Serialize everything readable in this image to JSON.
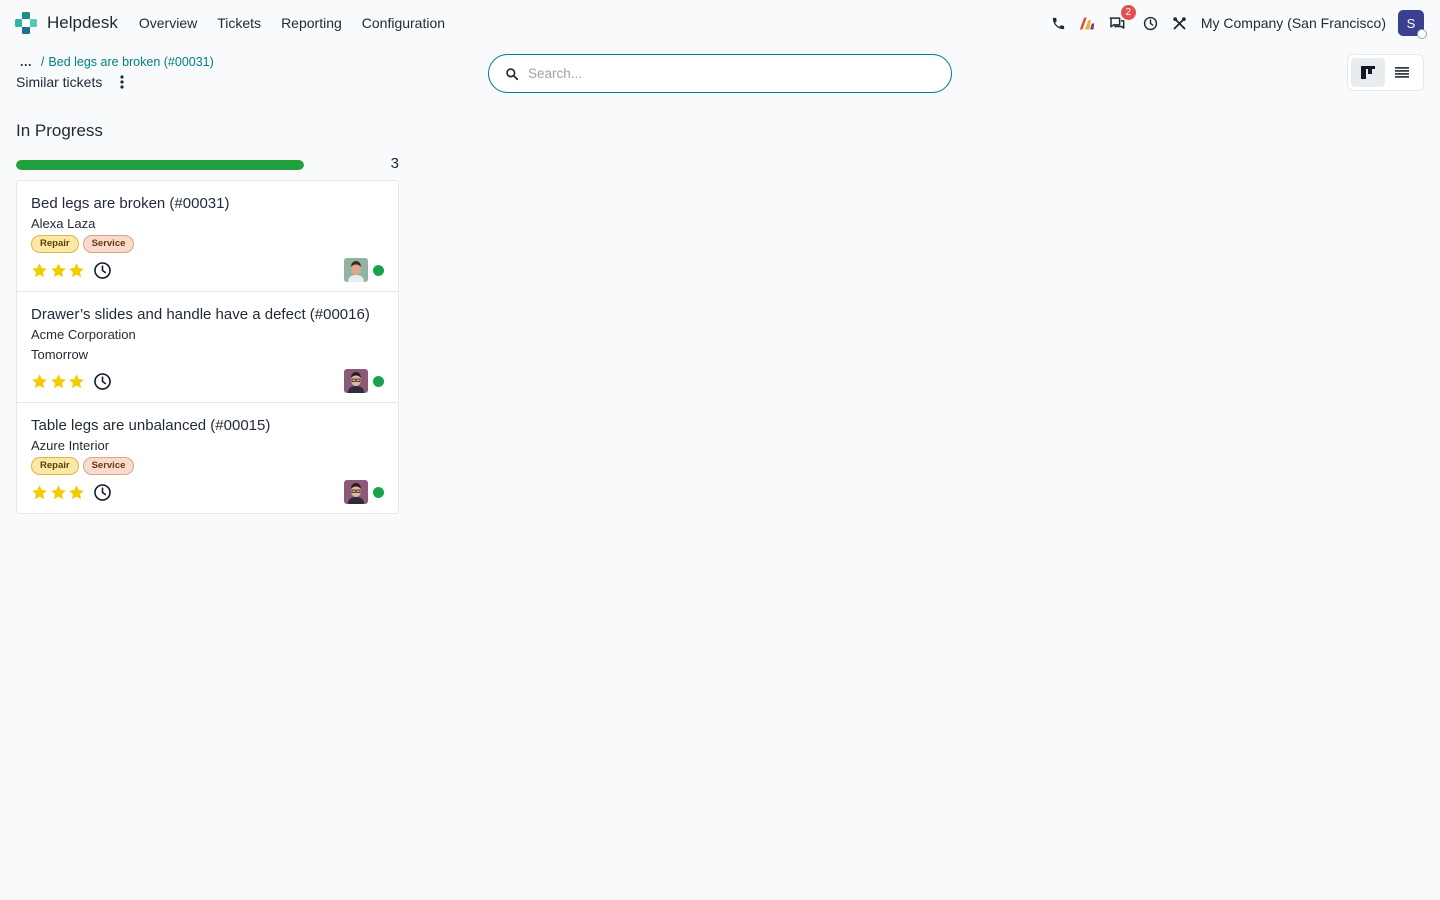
{
  "navbar": {
    "app_name": "Helpdesk",
    "menu": [
      "Overview",
      "Tickets",
      "Reporting",
      "Configuration"
    ],
    "messages_badge": "2",
    "company": "My Company (San Francisco)",
    "user_initial": "S"
  },
  "breadcrumb": {
    "ellipsis": "...",
    "separator": "/",
    "current": "Bed legs are broken (#00031)"
  },
  "view_title": "Similar tickets",
  "search": {
    "placeholder": "Search..."
  },
  "column": {
    "title": "In Progress",
    "count": "3",
    "progress_fraction": 1.0,
    "progress_color": "#22a040"
  },
  "cards": [
    {
      "title": "Bed legs are broken (#00031)",
      "customer": "Alexa Laza",
      "tags": [
        "Repair",
        "Service"
      ],
      "deadline": "",
      "stars": 3,
      "state_color": "#16a34a"
    },
    {
      "title": "Drawer’s slides and handle have a defect (#00016)",
      "customer": "Acme Corporation",
      "tags": [],
      "deadline": "Tomorrow",
      "stars": 3,
      "state_color": "#16a34a"
    },
    {
      "title": "Table legs are unbalanced (#00015)",
      "customer": "Azure Interior",
      "tags": [
        "Repair",
        "Service"
      ],
      "deadline": "",
      "stars": 3,
      "state_color": "#16a34a"
    }
  ],
  "colors": {
    "accent": "#017e84",
    "star": "#f3cc00",
    "tag_repair": "#fbe8a7",
    "tag_service": "#f7dccd",
    "badge": "#e3504f"
  }
}
